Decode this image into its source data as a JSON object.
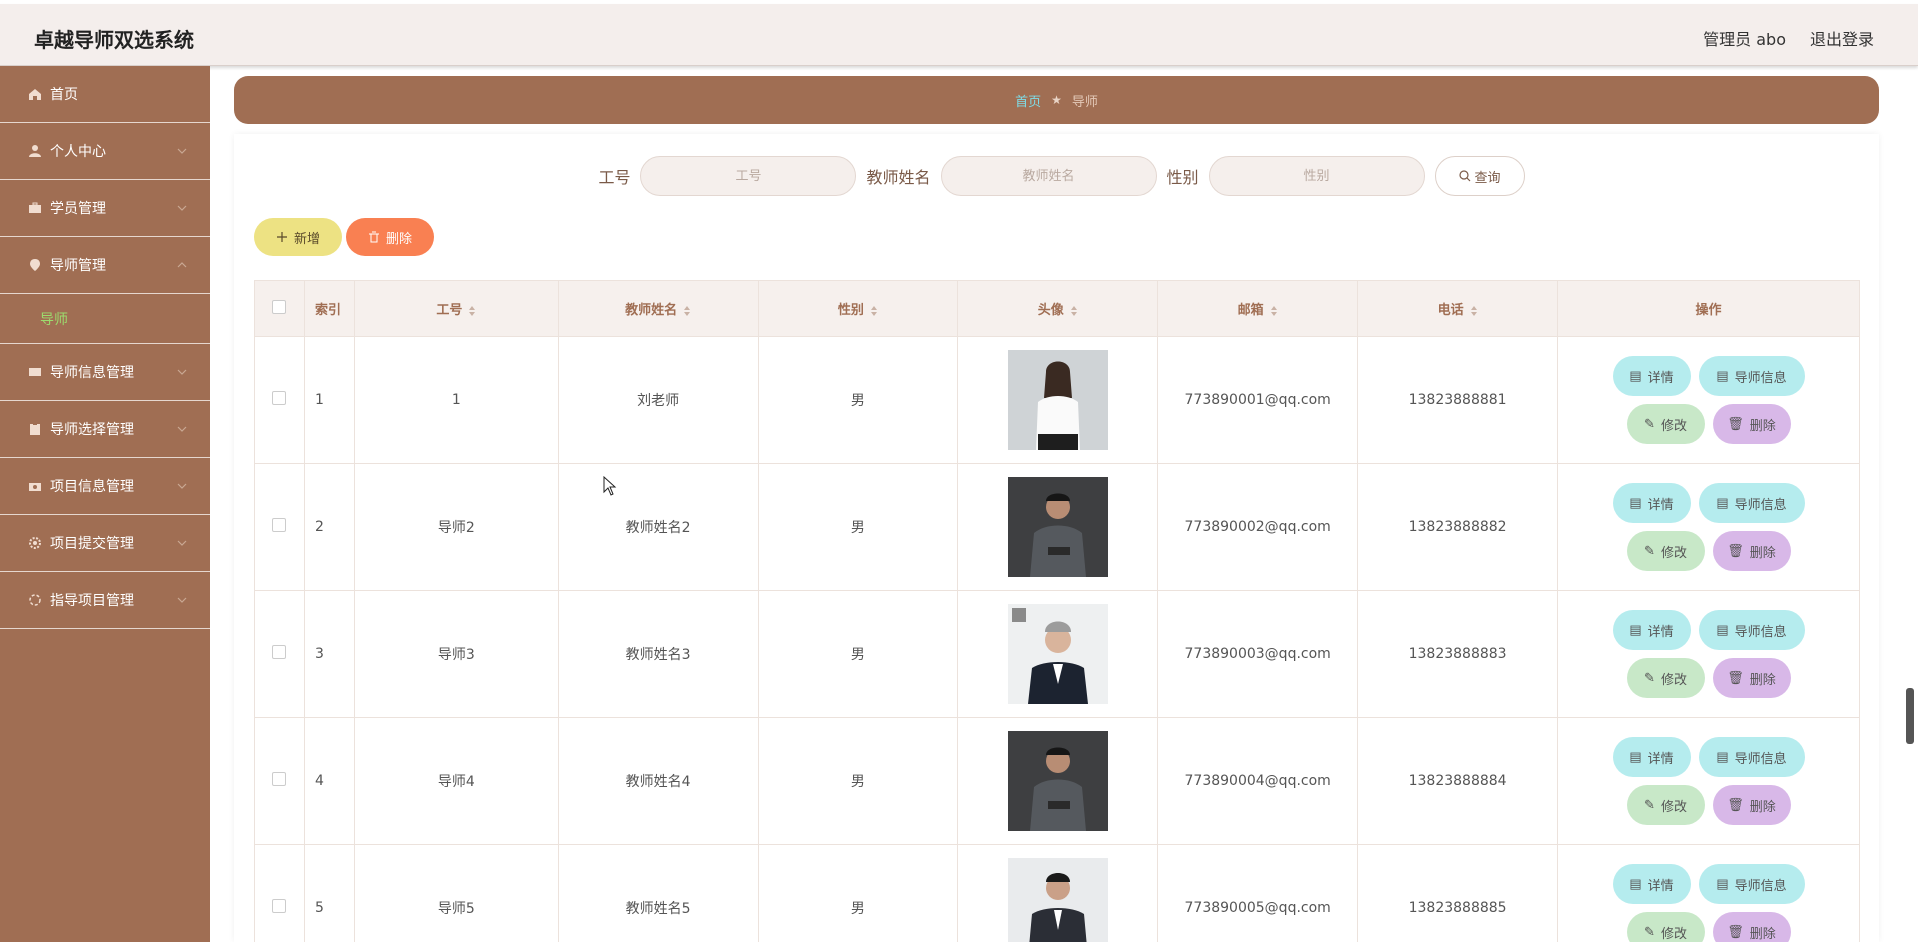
{
  "header": {
    "title": "卓越导师双选系统",
    "user": "管理员 abo",
    "logout": "退出登录"
  },
  "sidebar": {
    "items": [
      {
        "label": "首页",
        "icon": "home-icon"
      },
      {
        "label": "个人中心",
        "icon": "user-icon"
      },
      {
        "label": "学员管理",
        "icon": "briefcase-icon"
      },
      {
        "label": "导师管理",
        "icon": "location-pin-icon"
      },
      {
        "label": "导师信息管理",
        "icon": "ticket-icon"
      },
      {
        "label": "导师选择管理",
        "icon": "clipboard-icon"
      },
      {
        "label": "项目信息管理",
        "icon": "camera-icon"
      },
      {
        "label": "项目提交管理",
        "icon": "gear-icon"
      },
      {
        "label": "指导项目管理",
        "icon": "spinner-icon"
      }
    ],
    "sub_active": "导师"
  },
  "breadcrumb": {
    "home": "首页",
    "current": "导师"
  },
  "search": {
    "fields": [
      {
        "label": "工号",
        "placeholder": "工号"
      },
      {
        "label": "教师姓名",
        "placeholder": "教师姓名"
      },
      {
        "label": "性别",
        "placeholder": "性别"
      }
    ],
    "button": "查询"
  },
  "actions": {
    "add": "新增",
    "delete": "删除"
  },
  "table": {
    "columns": [
      "索引",
      "工号",
      "教师姓名",
      "性别",
      "头像",
      "邮箱",
      "电话",
      "操作"
    ],
    "rows": [
      {
        "index": "1",
        "id": "1",
        "name": "刘老师",
        "gender": "男",
        "email": "773890001@qq.com",
        "phone": "13823888881"
      },
      {
        "index": "2",
        "id": "导师2",
        "name": "教师姓名2",
        "gender": "男",
        "email": "773890002@qq.com",
        "phone": "13823888882"
      },
      {
        "index": "3",
        "id": "导师3",
        "name": "教师姓名3",
        "gender": "男",
        "email": "773890003@qq.com",
        "phone": "13823888883"
      },
      {
        "index": "4",
        "id": "导师4",
        "name": "教师姓名4",
        "gender": "男",
        "email": "773890004@qq.com",
        "phone": "13823888884"
      },
      {
        "index": "5",
        "id": "导师5",
        "name": "教师姓名5",
        "gender": "男",
        "email": "773890005@qq.com",
        "phone": "13823888885"
      }
    ],
    "ops": {
      "detail": "详情",
      "info": "导师信息",
      "edit": "修改",
      "delete": "删除"
    }
  },
  "colors": {
    "brand": "#a06e53",
    "active_sub": "#9cdc6e",
    "add_button": "#ede283",
    "delete_button": "#f98052"
  }
}
